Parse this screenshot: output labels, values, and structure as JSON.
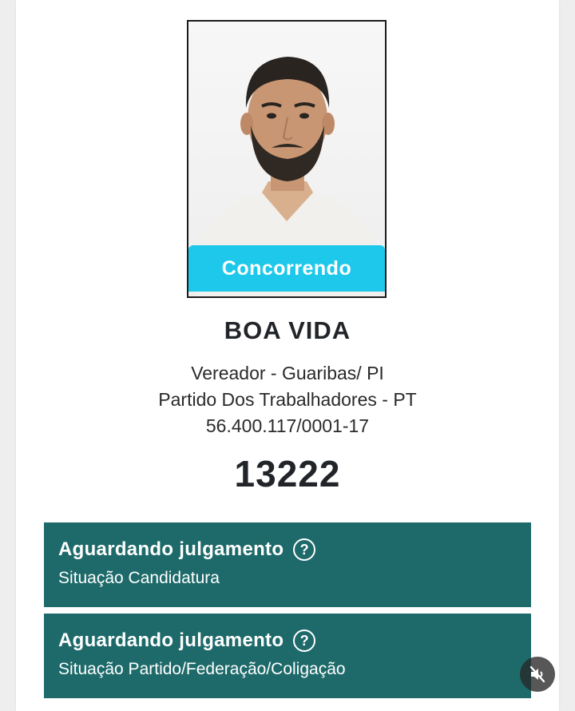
{
  "candidate": {
    "status_pill": "Concorrendo",
    "name": "BOA VIDA",
    "office": "Vereador - Guaribas/ PI",
    "party": "Partido Dos Trabalhadores - PT",
    "cnpj": "56.400.117/0001-17",
    "number": "13222"
  },
  "situations": [
    {
      "title": "Aguardando julgamento",
      "subtitle": "Situação Candidatura"
    },
    {
      "title": "Aguardando julgamento",
      "subtitle": "Situação Partido/Federação/Coligação"
    }
  ],
  "icons": {
    "help": "question-circle-icon",
    "mute": "speaker-muted-icon"
  },
  "colors": {
    "status_pill": "#1ec8ea",
    "situation_box": "#1e6a6a"
  }
}
